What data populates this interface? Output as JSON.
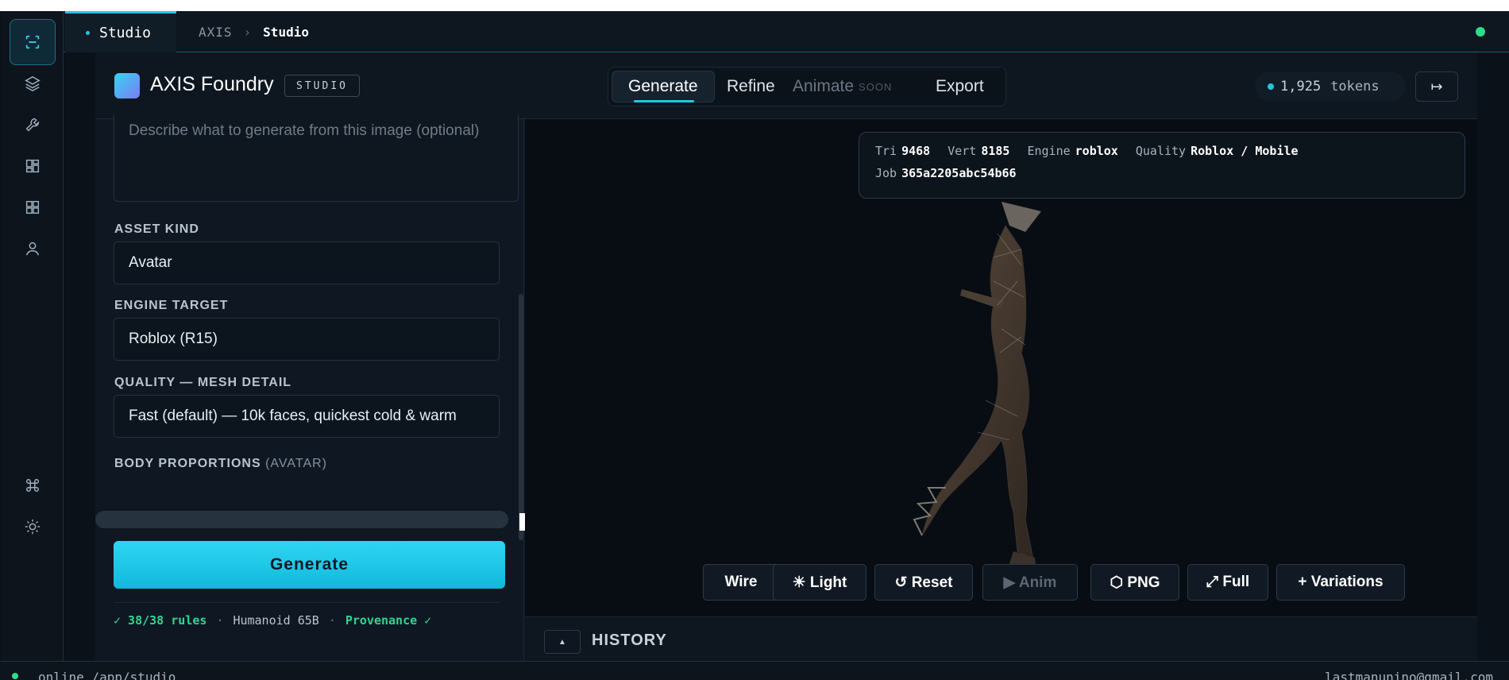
{
  "tabbar": {
    "tab_label": "Studio",
    "breadcrumb_root": "AXIS",
    "breadcrumb_sep": "›",
    "breadcrumb_current": "Studio"
  },
  "header": {
    "brand": "AXIS Foundry",
    "badge": "STUDIO",
    "modes": [
      {
        "label": "Generate",
        "active": true
      },
      {
        "label": "Refine"
      },
      {
        "label": "Animate",
        "tag": "SOON",
        "disabled": true
      },
      {
        "label": "Export"
      }
    ],
    "tokens_value": "1,925",
    "tokens_unit": "tokens",
    "expand_glyph": "↦"
  },
  "panel": {
    "prompt_placeholder": "Describe what to generate from this image (optional)",
    "asset_kind_label": "ASSET KIND",
    "asset_kind_value": "Avatar",
    "engine_target_label": "ENGINE TARGET",
    "engine_target_value": "Roblox (R15)",
    "quality_label": "QUALITY — MESH DETAIL",
    "quality_value": "Fast (default) — 10k faces, quickest cold & warm",
    "body_label": "BODY PROPORTIONS",
    "body_sub": "(AVATAR)",
    "generate_label": "Generate",
    "rules_ok": "✓ 38/38 rules",
    "sep": "·",
    "rules_model": "Humanoid 65B",
    "provenance": "Provenance ✓"
  },
  "viewport": {
    "tri_label": "Tri",
    "tri_value": "9468",
    "vert_label": "Vert",
    "vert_value": "8185",
    "engine_label": "Engine",
    "engine_value": "roblox",
    "quality_label": "Quality",
    "quality_value": "Roblox / Mobile",
    "job_label": "Job",
    "job_value": "365a2205abc54b66",
    "buttons": {
      "wire": "Wire",
      "light": "☀ Light",
      "reset": "↺ Reset",
      "anim": "▶ Anim",
      "png": "⬡ PNG",
      "full": "⤢ Full",
      "variations": "+ Variations"
    }
  },
  "history": {
    "toggle_glyph": "▲",
    "label": "HISTORY"
  },
  "footer": {
    "left": "online  /app/studio",
    "right": "lastmanunino@gmail.com"
  },
  "colors": {
    "accent": "#27c4e3",
    "ok": "#2fd591",
    "bg": "#0b1119"
  }
}
